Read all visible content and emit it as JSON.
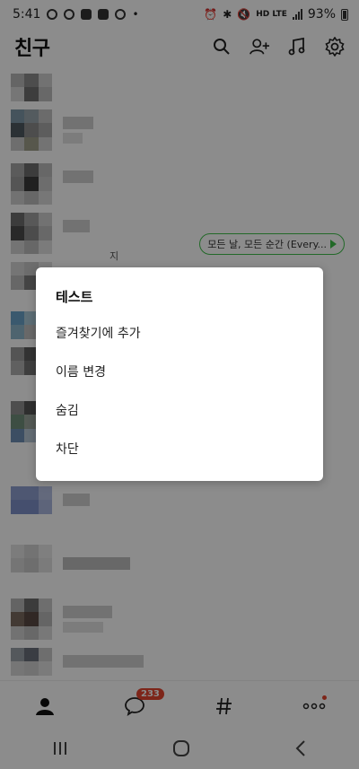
{
  "status_bar": {
    "time": "5:41",
    "network_label": "HD LTE",
    "battery_text": "93%"
  },
  "app_bar": {
    "title": "친구",
    "icons": [
      "search-icon",
      "add-friend-icon",
      "music-icon",
      "settings-icon"
    ]
  },
  "friend_list": {
    "status_message_text": "모든 날, 모든 순간 (Every...",
    "partial_name_text": "지"
  },
  "context_menu": {
    "title": "테스트",
    "items": [
      {
        "label": "즐겨찾기에 추가"
      },
      {
        "label": "이름 변경"
      },
      {
        "label": "숨김"
      },
      {
        "label": "차단"
      }
    ]
  },
  "tab_bar": {
    "tabs": [
      "friends-tab",
      "chats-tab",
      "openchat-tab",
      "more-tab"
    ],
    "chat_badge": "233"
  },
  "colors": {
    "accent_green": "#3fbf4a",
    "badge_red": "#e4442e",
    "dim_overlay": "rgba(0,0,0,0.45)"
  }
}
